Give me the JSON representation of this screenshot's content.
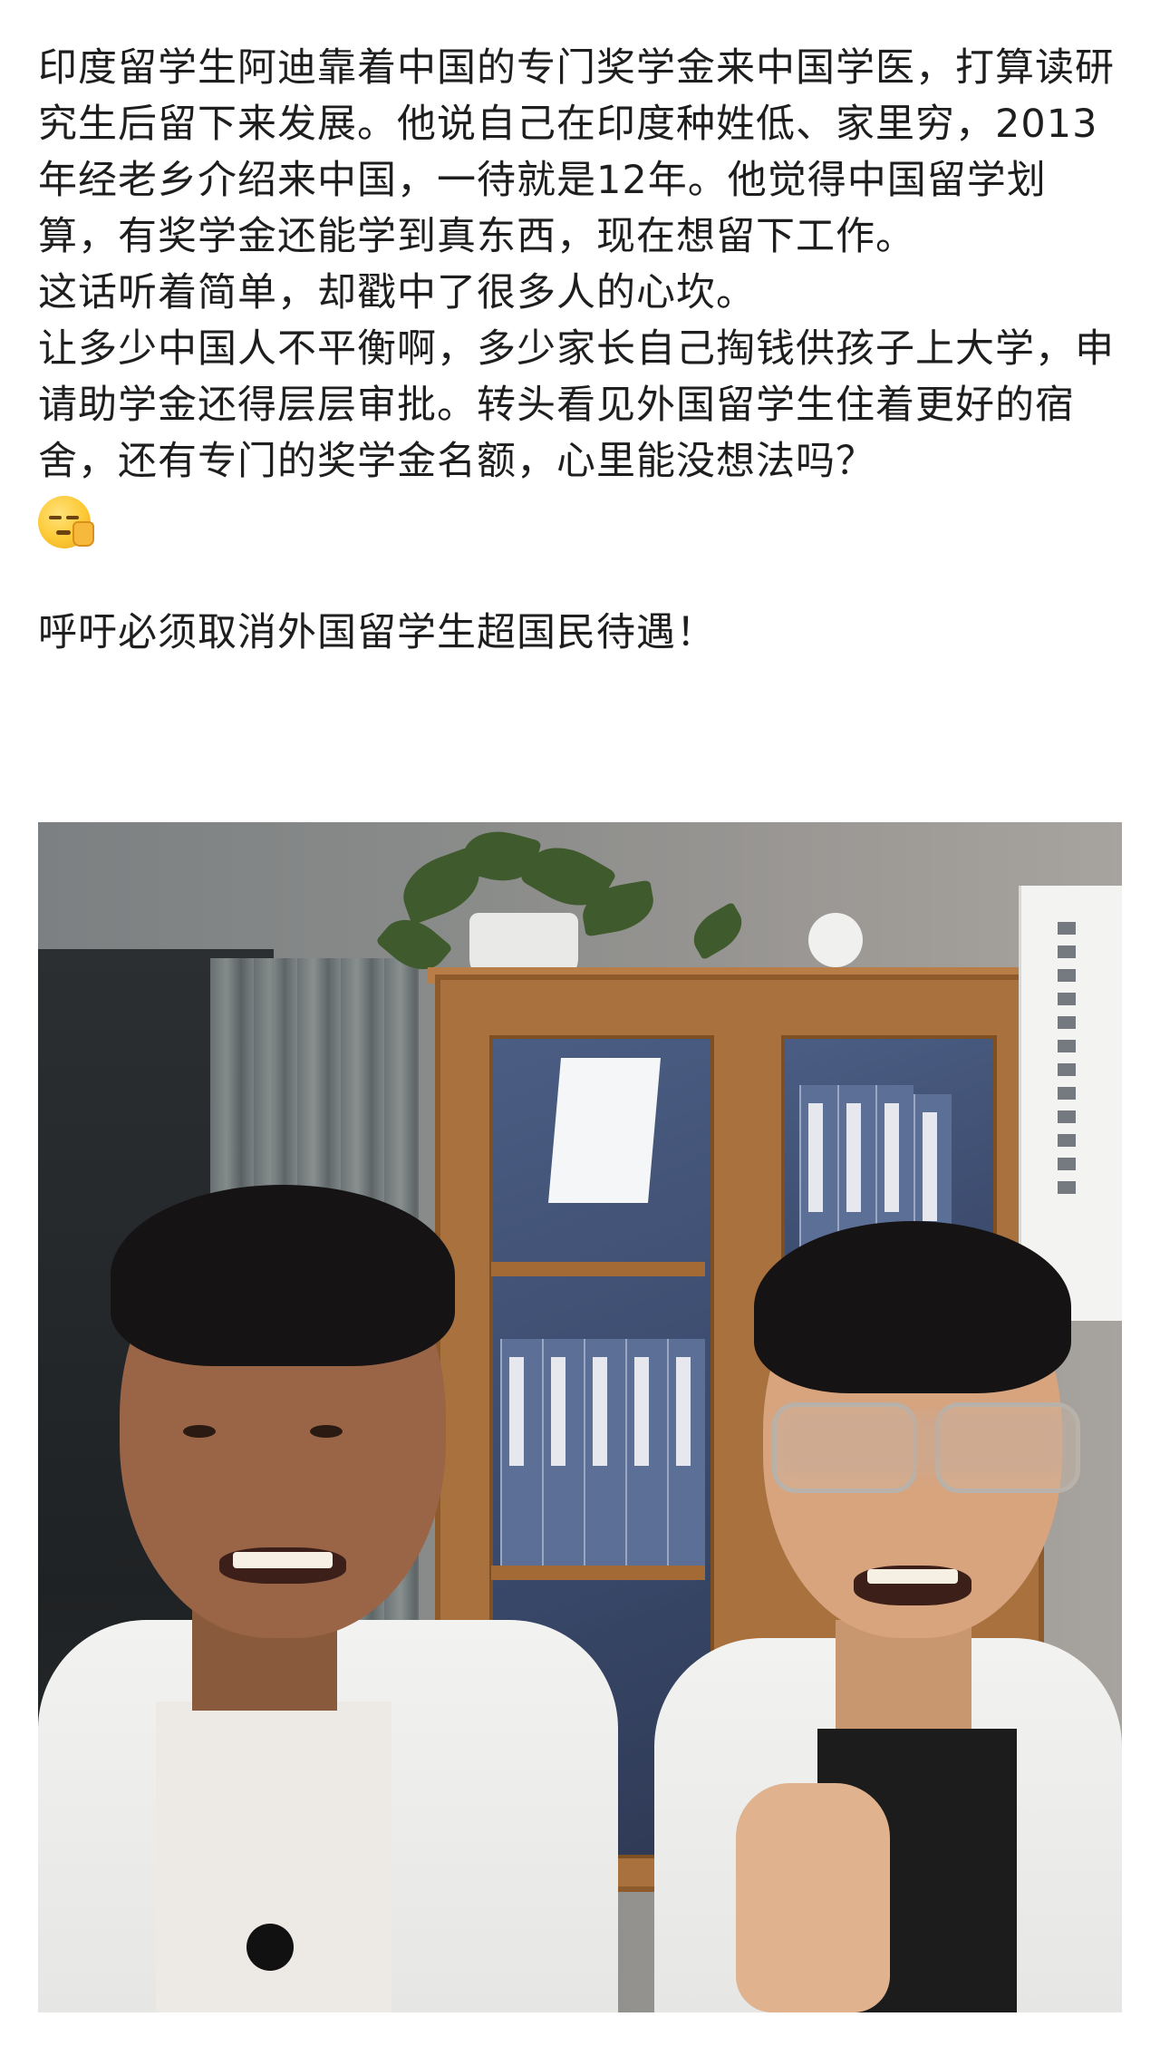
{
  "post": {
    "paragraphs": [
      "印度留学生阿迪靠着中国的专门奖学金来中国学医，打算读研究生后留下来发展。他说自己在印度种姓低、家里穷，2013年经老乡介绍来中国，一待就是12年。他觉得中国留学划算，有奖学金还能学到真东西，现在想留下工作。",
      "这话听着简单，却戳中了很多人的心坎。",
      "让多少中国人不平衡啊，多少家长自己掏钱供孩子上大学，申请助学金还得层层审批。转头看见外国留学生住着更好的宿舍，还有专门的奖学金名额，心里能没想法吗？"
    ],
    "emoji": "face-with-hand-over-mouth-icon",
    "appeal": "呼吁必须取消外国留学生超国民待遇！"
  },
  "photo": {
    "description_icon": "video-screenshot-photo"
  }
}
